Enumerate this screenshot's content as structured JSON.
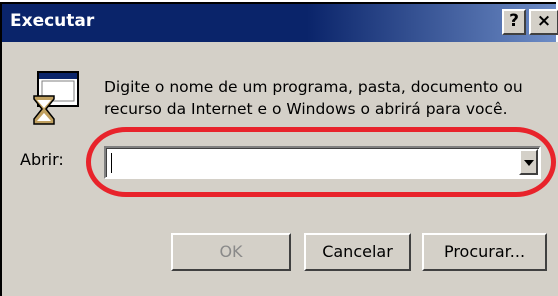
{
  "window": {
    "title": "Executar",
    "help_button": "?",
    "close_button": "×"
  },
  "description": "Digite o nome de um programa, pasta, documento ou recurso da Internet e o Windows o abrirá para você.",
  "open_field": {
    "label": "Abrir:",
    "value": ""
  },
  "buttons": {
    "ok": "OK",
    "cancel": "Cancelar",
    "browse": "Procurar..."
  },
  "icons": {
    "app": "run-program-icon",
    "dropdown": "chevron-down-icon"
  },
  "colors": {
    "title_bar": "#0a246a",
    "dialog_face": "#d4d0c8",
    "highlight_annotation": "#e8232b"
  }
}
